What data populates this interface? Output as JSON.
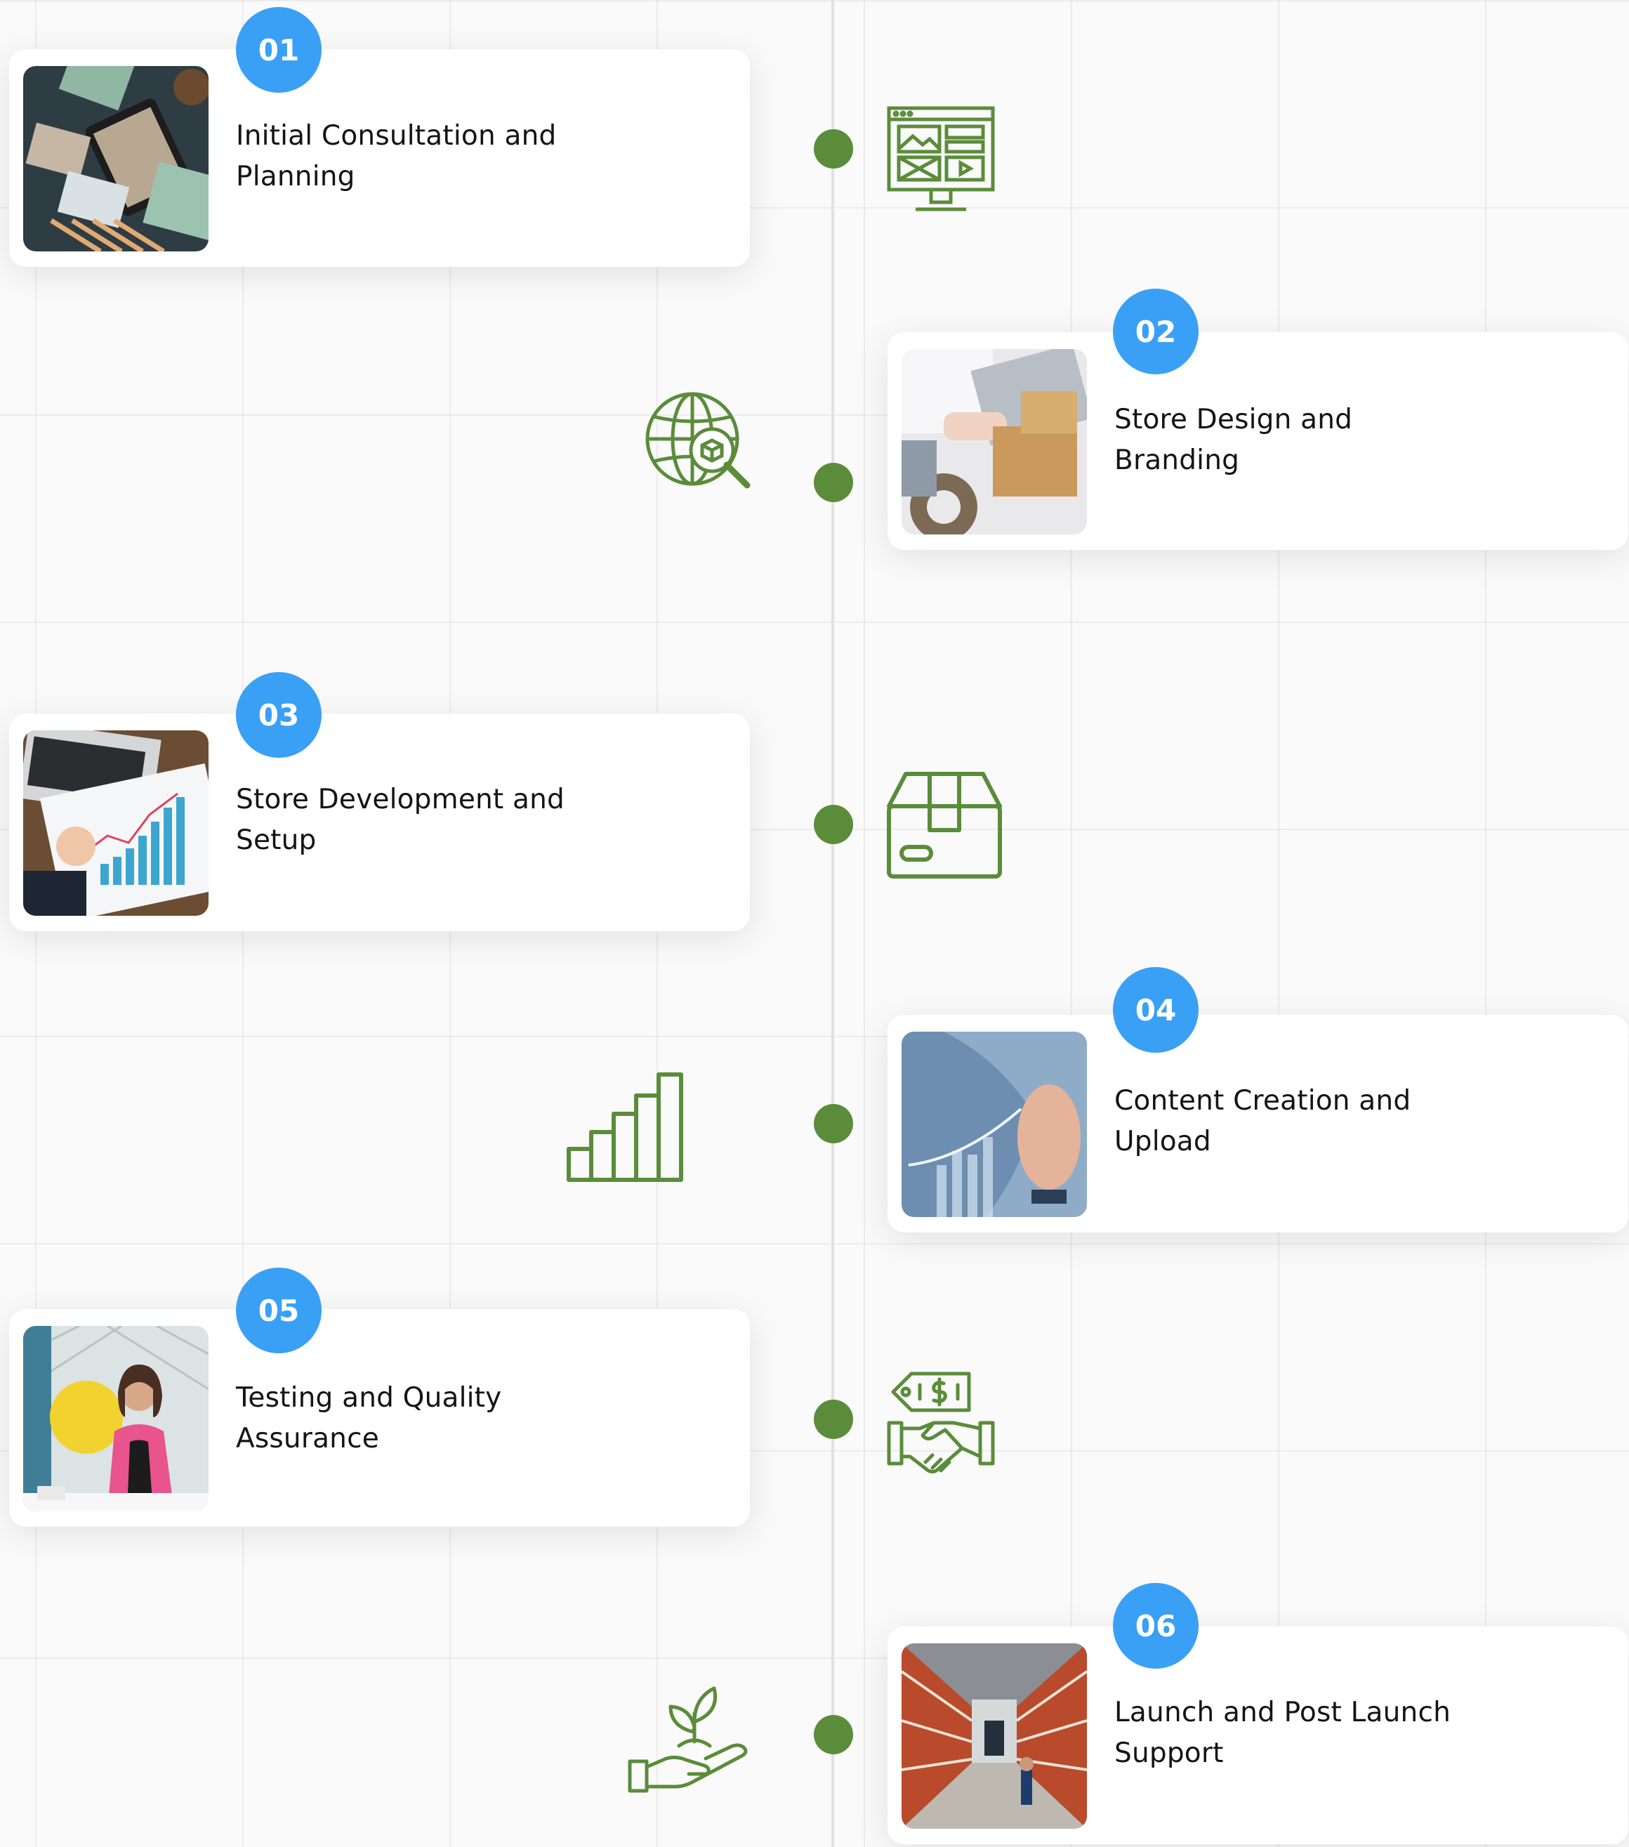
{
  "colors": {
    "accent_green": "#5b8c3a",
    "badge_blue": "#3aa0f5",
    "timeline_line": "#e1e1e1"
  },
  "steps": [
    {
      "number": "01",
      "title": "Initial Consultation and Planning",
      "icon": "web-design-monitor-icon"
    },
    {
      "number": "02",
      "title": "Store Design and Branding",
      "icon": "globe-search-icon"
    },
    {
      "number": "03",
      "title": "Store Development and Setup",
      "icon": "package-box-icon"
    },
    {
      "number": "04",
      "title": "Content Creation and Upload",
      "icon": "bar-growth-icon"
    },
    {
      "number": "05",
      "title": "Testing and Quality Assurance",
      "icon": "handshake-price-tag-icon"
    },
    {
      "number": "06",
      "title": "Launch and Post Launch Support",
      "icon": "plant-in-hand-icon"
    }
  ]
}
